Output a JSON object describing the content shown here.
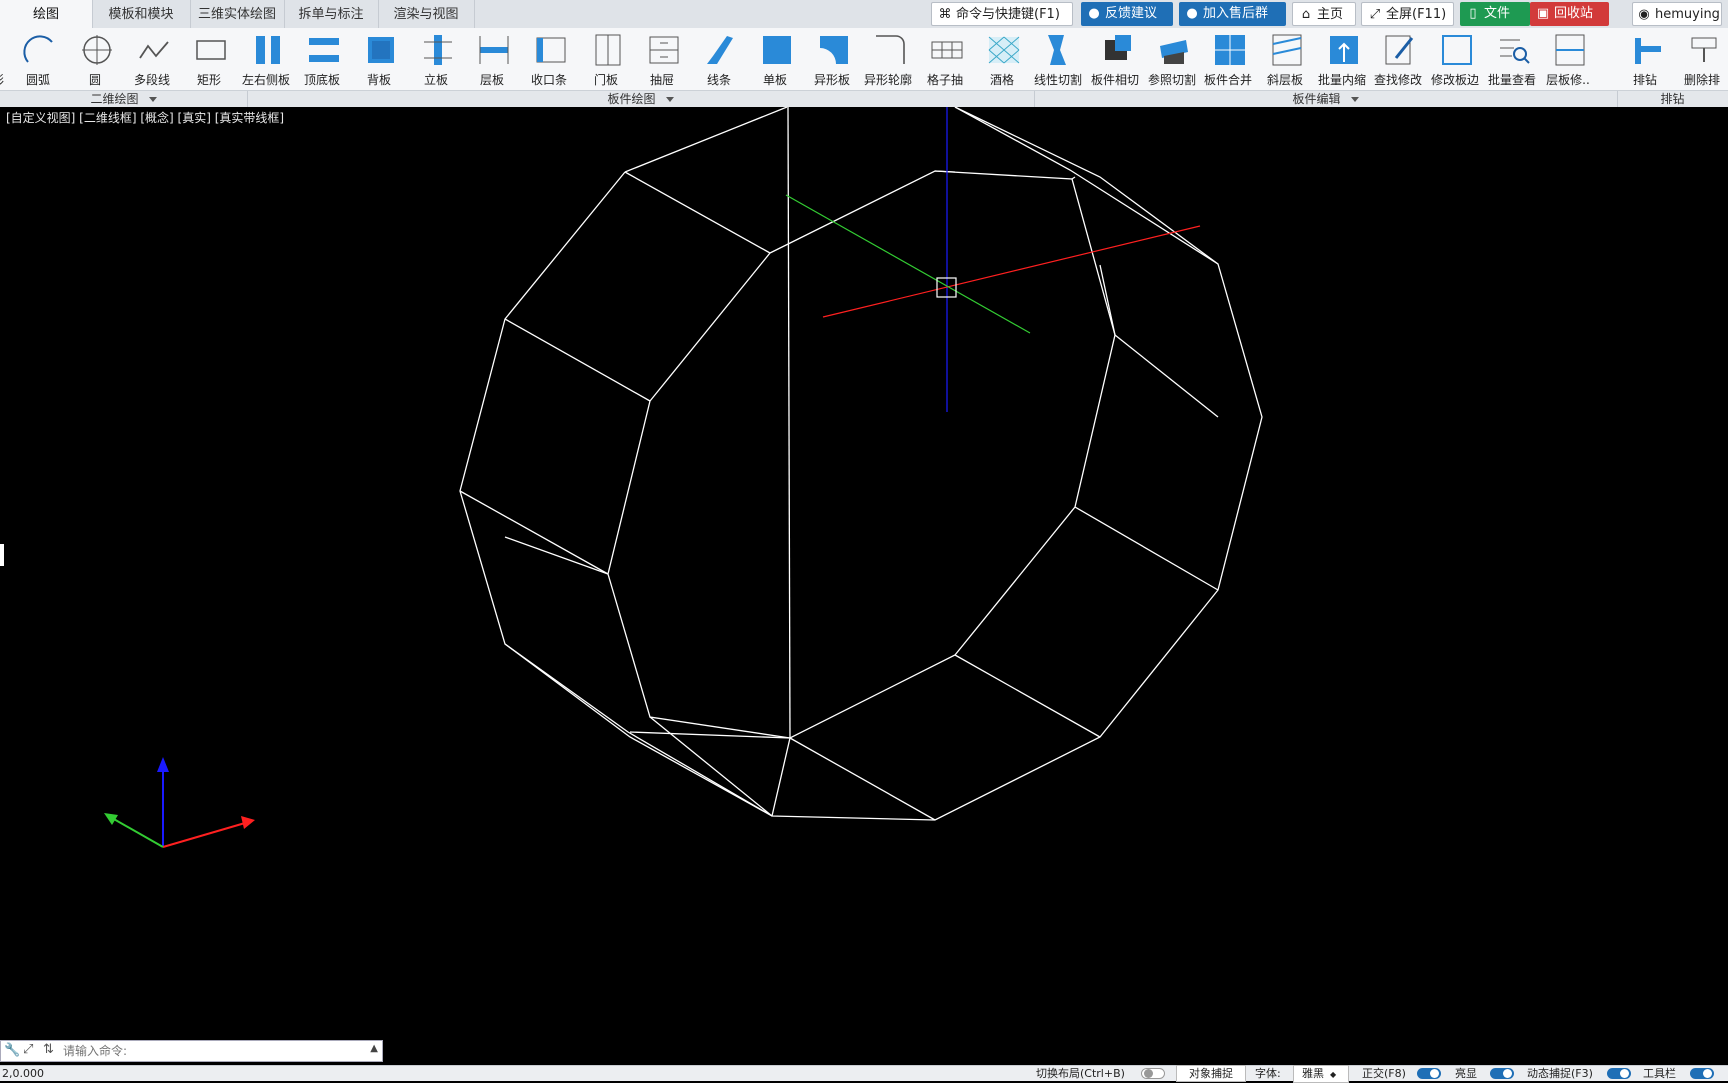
{
  "tabs": [
    {
      "label": "绘图",
      "active": true
    },
    {
      "label": "模板和模块"
    },
    {
      "label": "三维实体绘图"
    },
    {
      "label": "拆单与标注"
    },
    {
      "label": "渲染与视图"
    }
  ],
  "top_buttons": {
    "commands": "命令与快捷键(F1)",
    "feedback": "反馈建议",
    "aftersale": "加入售后群",
    "home": "主页",
    "fullscreen": "全屏(F11)",
    "file": "文件",
    "recycle": "回收站",
    "user": "hemuying"
  },
  "tools": [
    {
      "label": "圆弧",
      "icon": "arc-icon"
    },
    {
      "label": "圆",
      "icon": "circle-icon"
    },
    {
      "label": "多段线",
      "icon": "polyline-icon"
    },
    {
      "label": "矩形",
      "icon": "rectangle-icon"
    },
    {
      "label": "左右侧板",
      "icon": "side-panel-icon"
    },
    {
      "label": "顶底板",
      "icon": "top-bottom-panel-icon"
    },
    {
      "label": "背板",
      "icon": "back-panel-icon"
    },
    {
      "label": "立板",
      "icon": "vertical-panel-icon"
    },
    {
      "label": "层板",
      "icon": "shelf-icon"
    },
    {
      "label": "收口条",
      "icon": "closing-strip-icon"
    },
    {
      "label": "门板",
      "icon": "door-panel-icon"
    },
    {
      "label": "抽屉",
      "icon": "drawer-icon"
    },
    {
      "label": "线条",
      "icon": "molding-icon"
    },
    {
      "label": "单板",
      "icon": "single-board-icon"
    },
    {
      "label": "异形板",
      "icon": "irregular-board-icon"
    },
    {
      "label": "异形轮廓",
      "icon": "irregular-contour-icon"
    },
    {
      "label": "格子抽",
      "icon": "grid-drawer-icon"
    },
    {
      "label": "酒格",
      "icon": "wine-rack-icon"
    },
    {
      "label": "线性切割",
      "icon": "linear-cut-icon"
    },
    {
      "label": "板件相切",
      "icon": "board-tangent-icon"
    },
    {
      "label": "参照切割",
      "icon": "reference-cut-icon"
    },
    {
      "label": "板件合并",
      "icon": "board-merge-icon"
    },
    {
      "label": "斜层板",
      "icon": "slanted-shelf-icon"
    },
    {
      "label": "批量内缩",
      "icon": "batch-shrink-icon"
    },
    {
      "label": "查找修改",
      "icon": "find-modify-icon"
    },
    {
      "label": "修改板边",
      "icon": "modify-edge-icon"
    },
    {
      "label": "批量查看",
      "icon": "batch-view-icon"
    },
    {
      "label": "层板修..",
      "icon": "shelf-modify-icon"
    },
    {
      "label": "排钻",
      "icon": "drill-row-icon"
    },
    {
      "label": "删除排",
      "icon": "delete-drill-icon"
    }
  ],
  "groups": {
    "g1": "二维绘图",
    "g2": "板件绘图",
    "g3": "板件编辑",
    "g4": "排钻"
  },
  "viewport": {
    "label": "[自定义视图] [二维线框] [概念] [真实] [真实带线框]"
  },
  "command": {
    "placeholder": "请输入命令:",
    "coords": "2,0.000"
  },
  "status": {
    "layout_switch": "切换布局(Ctrl+B)",
    "osnap": "对象捕捉",
    "font_label": "字体:",
    "font_value": "雅黑",
    "ortho": "正交(F8)",
    "highlight": "亮显",
    "dynamic_snap": "动态捕捉(F3)",
    "toolbar": "工具栏"
  },
  "colors": {
    "accent_blue": "#1f6fb6",
    "file_green": "#1e9a52",
    "recycle_red": "#d23a3a",
    "wire": "#ffffff",
    "axis_x": "#ff2020",
    "axis_y": "#33cc33",
    "axis_z": "#1a1aff"
  }
}
